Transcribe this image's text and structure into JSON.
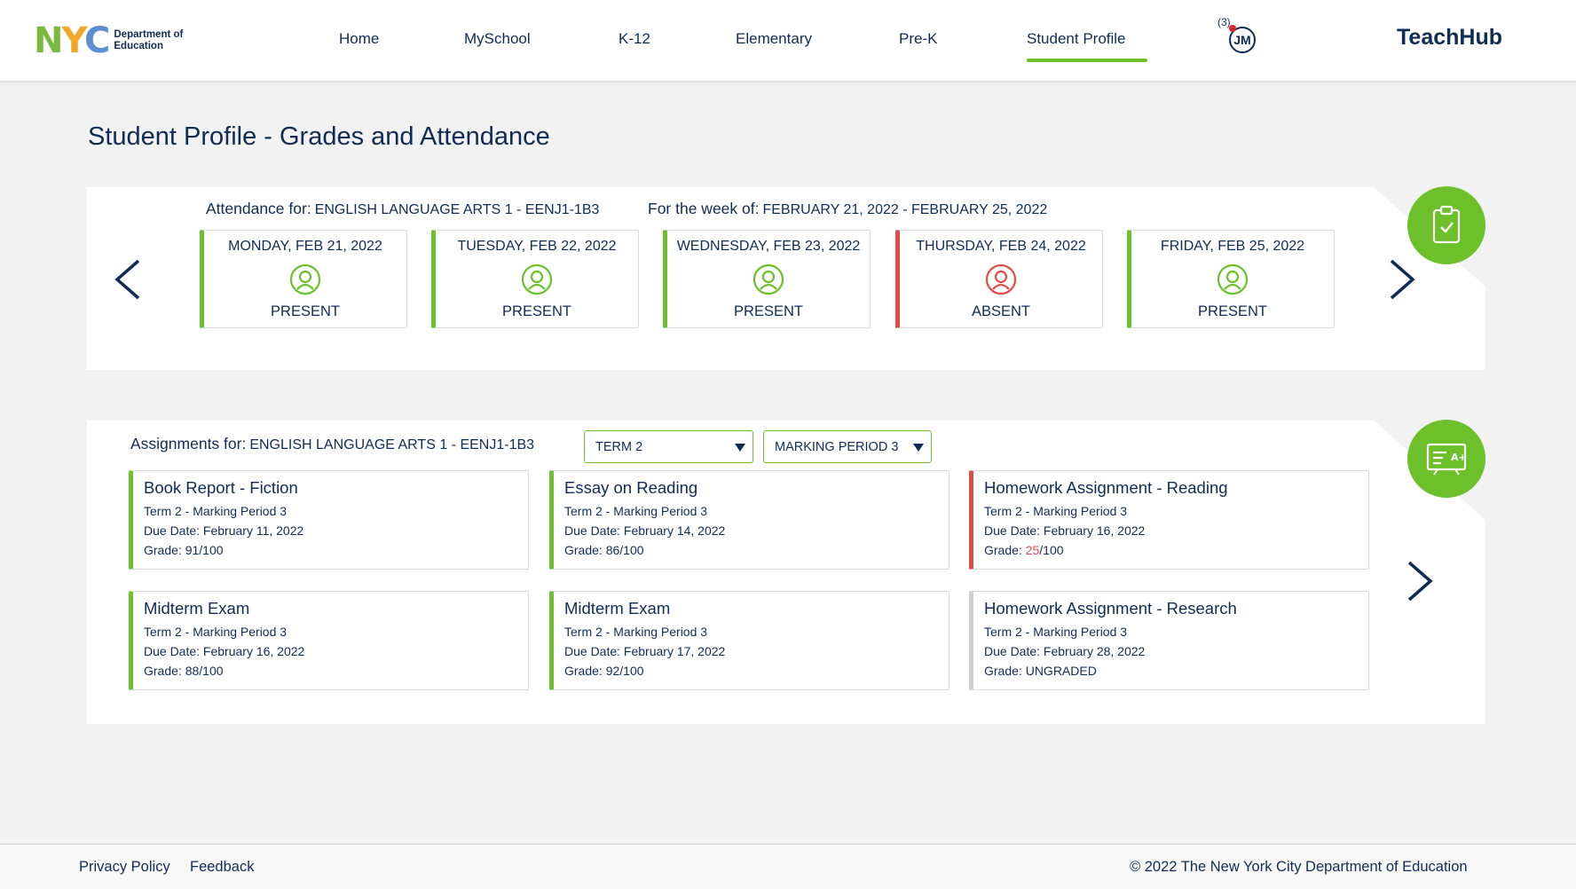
{
  "header": {
    "logo": {
      "nyc_n": "N",
      "nyc_y": "Y",
      "nyc_c": "C",
      "doe_line1": "Department of",
      "doe_line2": "Education"
    },
    "nav": [
      {
        "label": "Home"
      },
      {
        "label": "MySchool"
      },
      {
        "label": "K-12"
      },
      {
        "label": "Elementary"
      },
      {
        "label": "Pre-K"
      },
      {
        "label": "Student Profile",
        "active": true
      }
    ],
    "notification_count": "(3)",
    "avatar_initials": "JM",
    "brand": "TeachHub"
  },
  "page_title": "Student Profile - Grades and Attendance",
  "attendance": {
    "label": "Attendance for:",
    "course": "ENGLISH LANGUAGE ARTS 1 - EENJ1-1B3",
    "week_label": "For the week of:",
    "week_range": "FEBRUARY 21, 2022 - FEBRUARY 25, 2022",
    "days": [
      {
        "day": "MONDAY, FEB 21, 2022",
        "status": "PRESENT",
        "icon": "student-present-icon"
      },
      {
        "day": "TUESDAY, FEB 22, 2022",
        "status": "PRESENT",
        "icon": "student-present-icon"
      },
      {
        "day": "WEDNESDAY, FEB 23, 2022",
        "status": "PRESENT",
        "icon": "student-present-icon"
      },
      {
        "day": "THURSDAY, FEB 24, 2022",
        "status": "ABSENT",
        "icon": "student-absent-icon"
      },
      {
        "day": "FRIDAY, FEB 25, 2022",
        "status": "PRESENT",
        "icon": "student-present-icon"
      }
    ]
  },
  "assignments": {
    "label": "Assignments for:",
    "course": "ENGLISH LANGUAGE ARTS 1 - EENJ1-1B3",
    "term_select": "TERM 2",
    "period_select": "MARKING PERIOD 3",
    "items": [
      {
        "title": "Book Report - Fiction",
        "period": "Term 2 - Marking Period 3",
        "due": "Due Date: February 11, 2022",
        "grade_label": "Grade: ",
        "grade_score": "91",
        "grade_total": "/100"
      },
      {
        "title": "Essay on Reading",
        "period": "Term 2 - Marking Period 3",
        "due": "Due Date: February 14, 2022",
        "grade_label": "Grade: ",
        "grade_score": "86",
        "grade_total": "/100"
      },
      {
        "title": "Homework Assignment - Reading",
        "period": "Term 2 - Marking Period 3",
        "due": "Due Date: February 16, 2022",
        "grade_label": "Grade: ",
        "grade_score": "25",
        "grade_total": "/100"
      },
      {
        "title": "Midterm Exam",
        "period": "Term 2 - Marking Period 3",
        "due": "Due Date: February 16, 2022",
        "grade_label": "Grade: ",
        "grade_score": "88",
        "grade_total": "/100"
      },
      {
        "title": "Midterm Exam",
        "period": "Term 2 - Marking Period 3",
        "due": "Due Date: February 17, 2022",
        "grade_label": "Grade: ",
        "grade_score": "92",
        "grade_total": "/100"
      },
      {
        "title": "Homework Assignment - Research",
        "period": "Term 2 - Marking Period 3",
        "due": "Due Date: February 28, 2022",
        "grade_label": "Grade: ",
        "grade_score": "UNGRADED",
        "grade_total": ""
      }
    ]
  },
  "footer": {
    "privacy": "Privacy Policy",
    "feedback": "Feedback",
    "copyright": "© 2022 The New York City Department of Education"
  },
  "colors": {
    "navy": "#0f2c55",
    "green": "#6cc02a",
    "red": "#e04b4b",
    "grey_border": "#cfcfcf"
  }
}
